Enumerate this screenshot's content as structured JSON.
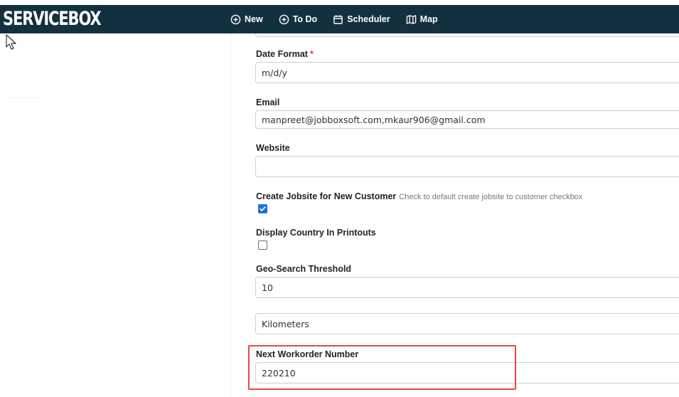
{
  "navbar": {
    "brand": "SERVICEBOX",
    "items": [
      {
        "label": "New",
        "icon": "plus-circle-icon"
      },
      {
        "label": "To Do",
        "icon": "plus-circle-icon"
      },
      {
        "label": "Scheduler",
        "icon": "calendar-icon"
      },
      {
        "label": "Map",
        "icon": "map-icon"
      }
    ]
  },
  "form": {
    "date_format": {
      "label": "Date Format",
      "required_mark": "*",
      "value": "m/d/y"
    },
    "email": {
      "label": "Email",
      "value": "manpreet@jobboxsoft.com,mkaur906@gmail.com"
    },
    "website": {
      "label": "Website",
      "value": ""
    },
    "create_jobsite": {
      "label": "Create Jobsite for New Customer",
      "hint": "Check to default create jobsite to customer checkbox",
      "checked": true
    },
    "display_country": {
      "label": "Display Country In Printouts",
      "checked": false
    },
    "geo_search": {
      "label": "Geo-Search Threshold",
      "value": "10"
    },
    "distance_unit": {
      "value": "Kilometers"
    },
    "next_workorder": {
      "label": "Next Workorder Number",
      "value": "220210"
    }
  },
  "colors": {
    "navbar_bg": "#13303f",
    "checkbox_checked": "#1f6fe0",
    "highlight": "#e5484d",
    "required": "#e03a3a"
  }
}
